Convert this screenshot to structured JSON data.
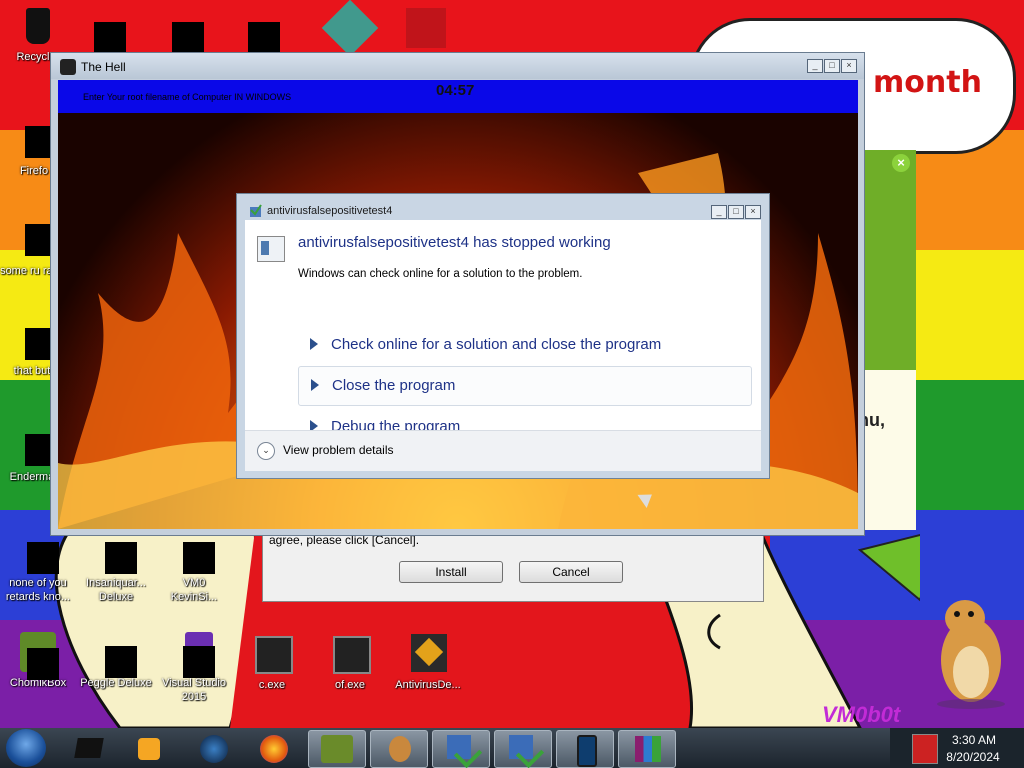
{
  "desktop": {
    "icons": [
      {
        "label": "Recycle"
      },
      {
        "label": "Firefo"
      },
      {
        "label": "some ru ran a"
      },
      {
        "label": "that but"
      },
      {
        "label": "Enderma"
      },
      {
        "label": "none of you retards kno..."
      },
      {
        "label": "Insaniquar... Deluxe"
      },
      {
        "label": "VM0 KevinSi..."
      },
      {
        "label": "ChomikBox"
      },
      {
        "label": "Peggle Deluxe"
      },
      {
        "label": "Visual Studio 2015"
      },
      {
        "label": "c.exe"
      },
      {
        "label": "of.exe"
      },
      {
        "label": "AntivirusDe..."
      }
    ],
    "bubble_text": "month",
    "side_text": "nu,",
    "brand_text": "VM0b0t"
  },
  "hell_window": {
    "title": "The Hell",
    "banner_text": "Enter Your root filename of Computer IN WINDOWS",
    "timer": "04:57"
  },
  "installer": {
    "text": "agree, please click [Cancel].",
    "install_label": "Install",
    "cancel_label": "Cancel"
  },
  "crash_dialog": {
    "title": "antivirusfalsepositivetest4",
    "heading": "antivirusfalsepositivetest4 has stopped working",
    "subtext": "Windows can check online for a solution to the problem.",
    "options": [
      "Check online for a solution and close the program",
      "Close the program",
      "Debug the program"
    ],
    "details_label": "View problem details"
  },
  "taskbar": {
    "clock_time": "3:30 AM",
    "clock_date": "8/20/2024"
  },
  "colors": {
    "accent": "#1e3287",
    "banner": "#0a08e8"
  }
}
